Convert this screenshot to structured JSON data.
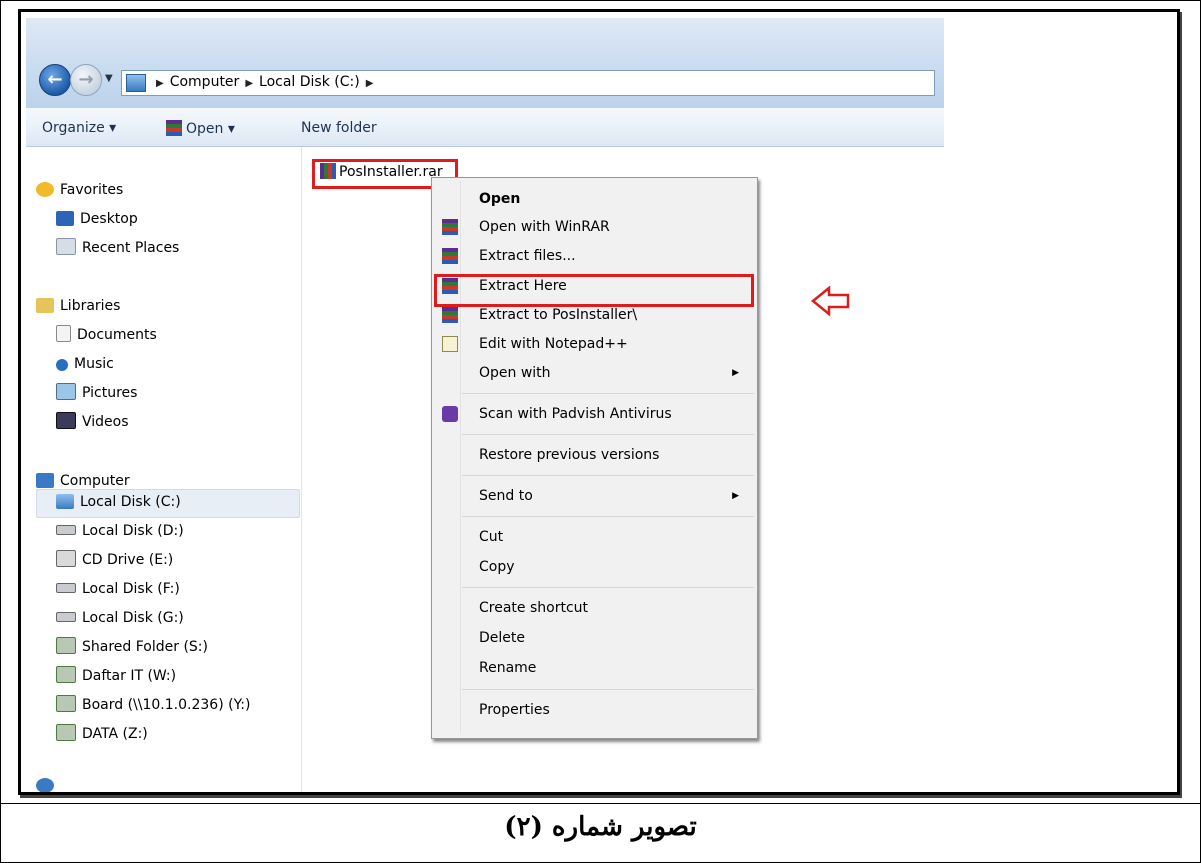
{
  "explorer": {
    "breadcrumb": [
      "Computer",
      "Local Disk (C:)"
    ],
    "toolbar": {
      "organize": "Organize ▾",
      "open": "Open ▾",
      "new_folder": "New folder"
    },
    "nav": {
      "favorites": "Favorites",
      "desktop": "Desktop",
      "recent": "Recent Places",
      "libraries": "Libraries",
      "documents": "Documents",
      "music": "Music",
      "pictures": "Pictures",
      "videos": "Videos",
      "computer": "Computer",
      "drives": [
        "Local Disk (C:)",
        "Local Disk (D:)",
        "CD Drive (E:)",
        "Local Disk (F:)",
        "Local Disk (G:)",
        "Shared Folder (S:)",
        "Daftar IT (W:)",
        "Board (\\\\10.1.0.236) (Y:)",
        "DATA (Z:)"
      ]
    },
    "file_name": "PosInstaller.rar"
  },
  "context_menu": {
    "open": "Open",
    "open_winrar": "Open with WinRAR",
    "extract_files": "Extract files...",
    "extract_here": "Extract Here",
    "extract_to": "Extract to PosInstaller\\",
    "edit_npp": "Edit with Notepad++",
    "open_with": "Open with",
    "scan": "Scan with Padvish Antivirus",
    "restore": "Restore previous versions",
    "send_to": "Send to",
    "cut": "Cut",
    "copy": "Copy",
    "create_shortcut": "Create shortcut",
    "delete": "Delete",
    "rename": "Rename",
    "properties": "Properties"
  },
  "caption": "تصویر شماره (۲)",
  "colors": {
    "highlight_red": "#e01b1b"
  }
}
